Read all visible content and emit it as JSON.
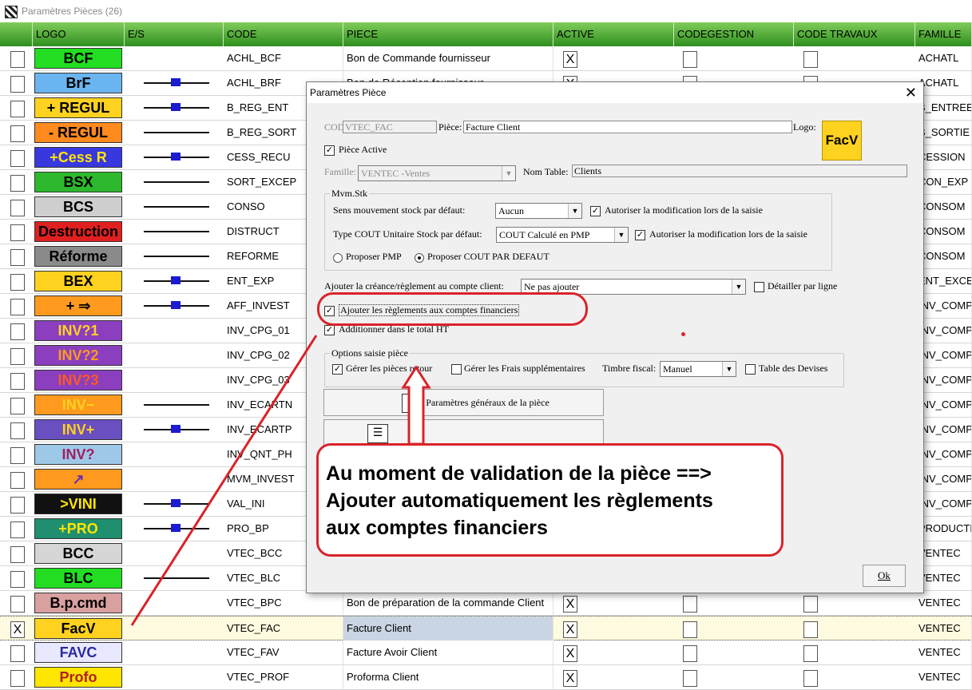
{
  "window": {
    "title": "Paramètres Pièces (26)"
  },
  "columns": [
    "LOGO",
    "E/S",
    "CODE",
    "PIECE",
    "ACTIVE",
    "CODEGESTION",
    "CODE TRAVAUX",
    "FAMILLE"
  ],
  "rows": [
    {
      "checked": "",
      "logo": {
        "text": "BCF",
        "bg": "#22dd22",
        "fg": "#000"
      },
      "es": "",
      "code": "ACHL_BCF",
      "piece": "Bon de Commande fournisseur",
      "active": "X",
      "famille": "ACHATL"
    },
    {
      "checked": "",
      "logo": {
        "text": "BrF",
        "bg": "#6ab4f0",
        "fg": "#000"
      },
      "es": "knob",
      "code": "ACHL_BRF",
      "piece": "Bon de Réception fournisseur",
      "active": "X",
      "famille": "ACHATL"
    },
    {
      "checked": "",
      "logo": {
        "text": "+ REGUL",
        "bg": "#ffd21f",
        "fg": "#000"
      },
      "es": "knob",
      "code": "B_REG_ENT",
      "piece": "",
      "active": "",
      "famille": "B_ENTREE"
    },
    {
      "checked": "",
      "logo": {
        "text": "- REGUL",
        "bg": "#ff8a1e",
        "fg": "#000"
      },
      "es": "bar",
      "code": "B_REG_SORT",
      "piece": "",
      "active": "",
      "famille": "B_SORTIE"
    },
    {
      "checked": "",
      "logo": {
        "text": "+Cess R",
        "bg": "#3838e0",
        "fg": "#ffe600"
      },
      "es": "knob",
      "code": "CESS_RECU",
      "piece": "",
      "active": "",
      "famille": "CESSION"
    },
    {
      "checked": "",
      "logo": {
        "text": "BSX",
        "bg": "#2db82d",
        "fg": "#000"
      },
      "es": "bar",
      "code": "SORT_EXCEP",
      "piece": "",
      "active": "",
      "famille": "CON_EXP"
    },
    {
      "checked": "",
      "logo": {
        "text": "BCS",
        "bg": "#cfcfcf",
        "fg": "#000"
      },
      "es": "bar",
      "code": "CONSO",
      "piece": "",
      "active": "",
      "famille": "CONSOM"
    },
    {
      "checked": "",
      "logo": {
        "text": "Destruction",
        "bg": "#e02020",
        "fg": "#000"
      },
      "es": "bar",
      "code": "DISTRUCT",
      "piece": "",
      "active": "",
      "famille": "CONSOM"
    },
    {
      "checked": "",
      "logo": {
        "text": "Réforme",
        "bg": "#8a8a8a",
        "fg": "#000"
      },
      "es": "bar",
      "code": "REFORME",
      "piece": "",
      "active": "",
      "famille": "CONSOM"
    },
    {
      "checked": "",
      "logo": {
        "text": "BEX",
        "bg": "#ffd21f",
        "fg": "#000"
      },
      "es": "knob",
      "code": "ENT_EXP",
      "piece": "",
      "active": "",
      "famille": "ENT_EXCEP"
    },
    {
      "checked": "",
      "logo": {
        "text": "+ ⇒",
        "bg": "#ff9a1e",
        "fg": "#000"
      },
      "es": "knob",
      "code": "AFF_INVEST",
      "piece": "",
      "active": "",
      "famille": "INV_COMPT"
    },
    {
      "checked": "",
      "logo": {
        "text": "INV?1",
        "bg": "#8b3fbf",
        "fg": "#ffd21f"
      },
      "es": "",
      "code": "INV_CPG_01",
      "piece": "",
      "active": "",
      "famille": "INV_COMPT"
    },
    {
      "checked": "",
      "logo": {
        "text": "INV?2",
        "bg": "#8b3fbf",
        "fg": "#ff9a1e"
      },
      "es": "",
      "code": "INV_CPG_02",
      "piece": "",
      "active": "",
      "famille": "INV_COMPT"
    },
    {
      "checked": "",
      "logo": {
        "text": "INV?3",
        "bg": "#8b3fbf",
        "fg": "#ff5a1e"
      },
      "es": "",
      "code": "INV_CPG_03",
      "piece": "",
      "active": "",
      "famille": "INV_COMPT"
    },
    {
      "checked": "",
      "logo": {
        "text": "INV−",
        "bg": "#ff9a1e",
        "fg": "#ffd21f"
      },
      "es": "bar",
      "code": "INV_ECARTN",
      "piece": "",
      "active": "",
      "famille": "INV_COMPT"
    },
    {
      "checked": "",
      "logo": {
        "text": "INV+",
        "bg": "#6a4fc0",
        "fg": "#ffd21f"
      },
      "es": "knob",
      "code": "INV_ECARTP",
      "piece": "",
      "active": "",
      "famille": "INV_COMPT"
    },
    {
      "checked": "",
      "logo": {
        "text": "INV?",
        "bg": "#9ec8e8",
        "fg": "#a02060"
      },
      "es": "",
      "code": "INV_QNT_PH",
      "piece": "",
      "active": "",
      "famille": "INV_COMPT"
    },
    {
      "checked": "",
      "logo": {
        "text": "↗",
        "bg": "#ff9a1e",
        "fg": "#6a2fb0"
      },
      "es": "",
      "code": "MVM_INVEST",
      "piece": "",
      "active": "",
      "famille": "INV_COMPT"
    },
    {
      "checked": "",
      "logo": {
        "text": ">VINI",
        "bg": "#111111",
        "fg": "#ffe600"
      },
      "es": "knob",
      "code": "VAL_INI",
      "piece": "",
      "active": "",
      "famille": "INV_COMPT"
    },
    {
      "checked": "",
      "logo": {
        "text": "+PRO",
        "bg": "#1f8f6f",
        "fg": "#ffe600"
      },
      "es": "knob",
      "code": "PRO_BP",
      "piece": "",
      "active": "",
      "famille": "PRODUCTION"
    },
    {
      "checked": "",
      "logo": {
        "text": "BCC",
        "bg": "#d6d6d6",
        "fg": "#000"
      },
      "es": "",
      "code": "VTEC_BCC",
      "piece": "",
      "active": "",
      "famille": "VENTEC"
    },
    {
      "checked": "",
      "logo": {
        "text": "BLC",
        "bg": "#22dd22",
        "fg": "#000"
      },
      "es": "bar",
      "code": "VTEC_BLC",
      "piece": "",
      "active": "",
      "famille": "VENTEC"
    },
    {
      "checked": "",
      "logo": {
        "text": "B.p.cmd",
        "bg": "#d9a0a0",
        "fg": "#000"
      },
      "es": "",
      "code": "VTEC_BPC",
      "piece": "Bon de préparation de la commande Client",
      "active": "X",
      "famille": "VENTEC"
    },
    {
      "checked": "X",
      "logo": {
        "text": "FacV",
        "bg": "#ffd21f",
        "fg": "#000"
      },
      "es": "",
      "code": "VTEC_FAC",
      "piece": "Facture Client",
      "active": "X",
      "famille": "VENTEC",
      "selected": true
    },
    {
      "checked": "",
      "logo": {
        "text": "FAVC",
        "bg": "#e8e8ff",
        "fg": "#2a2aa0"
      },
      "es": "",
      "code": "VTEC_FAV",
      "piece": "Facture Avoir Client",
      "active": "X",
      "famille": "VENTEC"
    },
    {
      "checked": "",
      "logo": {
        "text": "Profo",
        "bg": "#ffe600",
        "fg": "#b02020"
      },
      "es": "",
      "code": "VTEC_PROF",
      "piece": "Proforma Client",
      "active": "X",
      "famille": "VENTEC"
    }
  ],
  "dialog": {
    "title": "Paramètres Pièce",
    "code_label": "CODE:",
    "code_value": "VTEC_FAC",
    "piece_label": "Pièce:",
    "piece_value": "Facture Client",
    "logo_label": "Logo:",
    "logo_text": "FacV",
    "piece_active_label": "Pièce Active",
    "famille_label": "Famille:",
    "famille_value": "VENTEC    -Ventes",
    "nom_table_label": "Nom Table:",
    "nom_table_value": "Clients",
    "mvm_group": "Mvm.Stk",
    "sens_label": "Sens mouvement stock par défaut:",
    "sens_value": "Aucun",
    "autoriser1": "Autoriser la modification lors de la saisie",
    "type_cout_label": "Type COUT Unitaire Stock par défaut:",
    "type_cout_value": "COUT Calculé en PMP",
    "autoriser2": "Autoriser la modification lors de la saisie",
    "radio1": "Proposer PMP",
    "radio2": "Proposer COUT PAR DEFAUT",
    "creance_label": "Ajouter la créance/règlement au compte client:",
    "creance_value": "Ne pas ajouter",
    "detailler": "Détailler par ligne",
    "ajouter_regl": "Ajouter les règlements aux comptes financiers",
    "additionner": "Additionner dans le total HT",
    "options_group": "Options saisie pièce",
    "gerer_retour": "Gérer les pièces retour",
    "gerer_frais": "Gérer les Frais supplémentaires",
    "timbre_label": "Timbre fiscal:",
    "timbre_value": "Manuel",
    "table_devises": "Table des Devises",
    "btn_params": "Paramètres généraux de la pièce",
    "ok": "Ok"
  },
  "annotation": {
    "line1": "Au moment de validation de la pièce ==>",
    "line2": "Ajouter automatiquement les règlements",
    "line3": "aux comptes financiers",
    "color": "#d9232a"
  }
}
